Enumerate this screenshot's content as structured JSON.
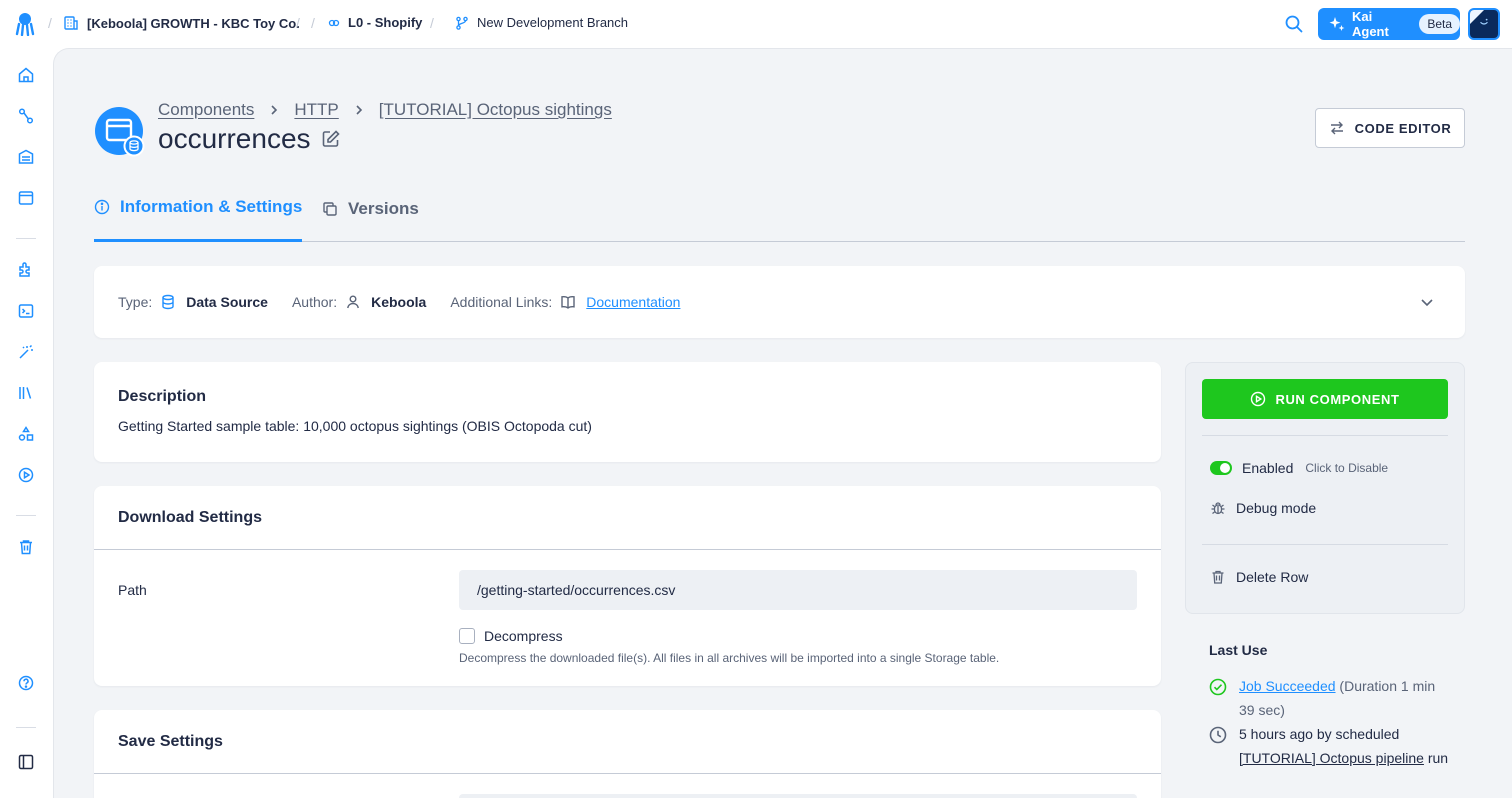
{
  "topbar": {
    "project": "[Keboola] GROWTH - KBC Toy Co.",
    "sub_project": "L0 - Shopify",
    "branch": "New Development Branch",
    "kai_label": "Kai Agent",
    "kai_badge": "Beta"
  },
  "breadcrumbs": [
    "Components",
    "HTTP",
    "[TUTORIAL] Octopus sightings"
  ],
  "title": "occurrences",
  "code_editor_label": "CODE EDITOR",
  "tabs": [
    {
      "label": "Information & Settings",
      "active": true
    },
    {
      "label": "Versions",
      "active": false
    }
  ],
  "info": {
    "type_label": "Type:",
    "type_value": "Data Source",
    "author_label": "Author:",
    "author_value": "Keboola",
    "links_label": "Additional Links:",
    "links_value": "Documentation"
  },
  "description": {
    "heading": "Description",
    "text": "Getting Started sample table: 10,000 octopus sightings (OBIS Octopoda cut)"
  },
  "download_settings": {
    "heading": "Download Settings",
    "path_label": "Path",
    "path_value": "/getting-started/occurrences.csv",
    "decompress_label": "Decompress",
    "decompress_checked": false,
    "decompress_help": "Decompress the downloaded file(s). All files in all archives will be imported into a single Storage table."
  },
  "save_settings": {
    "heading": "Save Settings"
  },
  "side_panel": {
    "run_label": "RUN COMPONENT",
    "enabled_label": "Enabled",
    "enabled_hint": "Click to Disable",
    "debug_label": "Debug mode",
    "delete_label": "Delete Row"
  },
  "last_use": {
    "heading": "Last Use",
    "job_link": "Job Succeeded",
    "job_duration": "(Duration 1 min 39 sec)",
    "time_text": "5 hours ago by scheduled",
    "pipeline_link": "[TUTORIAL] Octopus pipeline",
    "run_text": "run"
  },
  "colors": {
    "accent": "#1f8fff",
    "success": "#1ec71e",
    "text": "#222b45",
    "muted": "#5a6478"
  }
}
